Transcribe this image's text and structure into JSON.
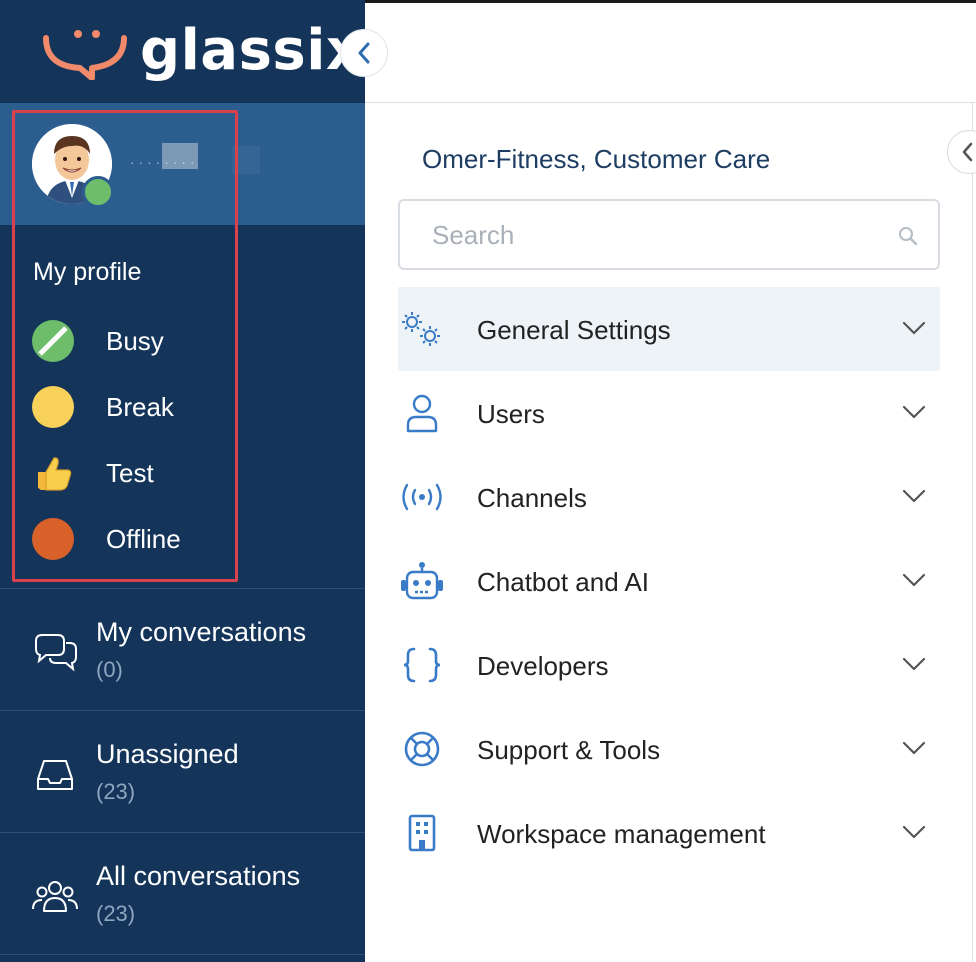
{
  "brand": {
    "name": "glassix",
    "accent": "#f08a6a",
    "sidebar_bg": "#14345a"
  },
  "user": {
    "name": "· · · · ·  · · ·",
    "status_color": "#6dbd6b"
  },
  "profile": {
    "title": "My profile",
    "statuses": [
      {
        "label": "Busy",
        "color": "#6dbd6b",
        "icon": "busy-status-icon"
      },
      {
        "label": "Break",
        "color": "#f8d15a",
        "icon": "break-status-icon"
      },
      {
        "label": "Test",
        "color": "#f5c842",
        "icon": "thumbs-up-icon"
      },
      {
        "label": "Offline",
        "color": "#d9622b",
        "icon": "offline-status-icon"
      }
    ]
  },
  "nav": [
    {
      "title": "My conversations",
      "count": "(0)",
      "icon": "chat-bubbles-icon"
    },
    {
      "title": "Unassigned",
      "count": "(23)",
      "icon": "inbox-icon"
    },
    {
      "title": "All conversations",
      "count": "(23)",
      "icon": "users-group-icon"
    }
  ],
  "main": {
    "org_title": "Omer-Fitness, Customer Care",
    "search": {
      "placeholder": "Search",
      "value": ""
    },
    "menu": [
      {
        "label": "General Settings",
        "icon": "gears-icon",
        "active": true
      },
      {
        "label": "Users",
        "icon": "user-icon",
        "active": false
      },
      {
        "label": "Channels",
        "icon": "broadcast-icon",
        "active": false
      },
      {
        "label": "Chatbot and AI",
        "icon": "robot-icon",
        "active": false
      },
      {
        "label": "Developers",
        "icon": "braces-icon",
        "active": false
      },
      {
        "label": "Support & Tools",
        "icon": "lifebuoy-icon",
        "active": false
      },
      {
        "label": "Workspace management",
        "icon": "building-icon",
        "active": false
      }
    ]
  }
}
